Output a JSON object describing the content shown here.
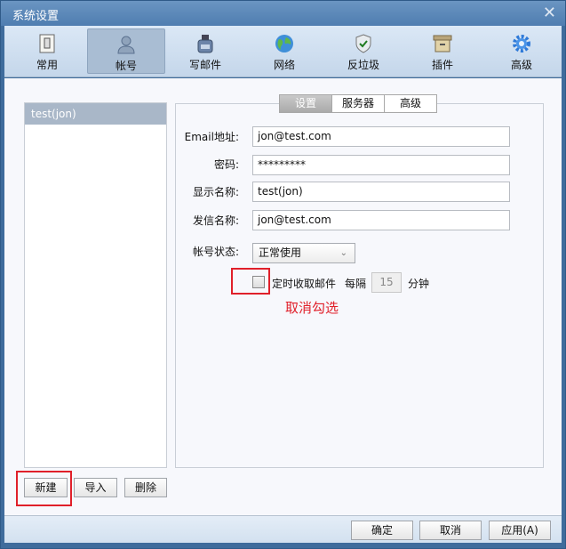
{
  "window": {
    "title": "系统设置",
    "close_icon": "close-icon"
  },
  "toolbar": {
    "items": [
      {
        "label": "常用",
        "icon": "switch-icon"
      },
      {
        "label": "帐号",
        "icon": "user-icon",
        "selected": true
      },
      {
        "label": "写邮件",
        "icon": "ink-bottle-icon"
      },
      {
        "label": "网络",
        "icon": "globe-icon"
      },
      {
        "label": "反垃圾",
        "icon": "shield-check-icon"
      },
      {
        "label": "插件",
        "icon": "box-icon"
      },
      {
        "label": "高级",
        "icon": "gear-icon"
      }
    ]
  },
  "accounts": {
    "items": [
      "test(jon)"
    ],
    "buttons": {
      "new": "新建",
      "import": "导入",
      "delete": "删除"
    }
  },
  "tabs": [
    "设置",
    "服务器",
    "高级"
  ],
  "form": {
    "email_label": "Email地址:",
    "email_value": "jon@test.com",
    "password_label": "密码:",
    "password_value": "*********",
    "display_label": "显示名称:",
    "display_value": "test(jon)",
    "sender_label": "发信名称:",
    "sender_value": "jon@test.com",
    "status_label": "帐号状态:",
    "status_value": "正常使用",
    "auto_fetch_label": "定时收取邮件",
    "auto_fetch_checked": false,
    "interval_prefix": "每隔",
    "interval_value": "15",
    "interval_suffix": "分钟"
  },
  "annotation": {
    "text": "取消勾选",
    "color": "#e0202a"
  },
  "footer": {
    "ok": "确定",
    "cancel": "取消",
    "apply": "应用(A)"
  }
}
